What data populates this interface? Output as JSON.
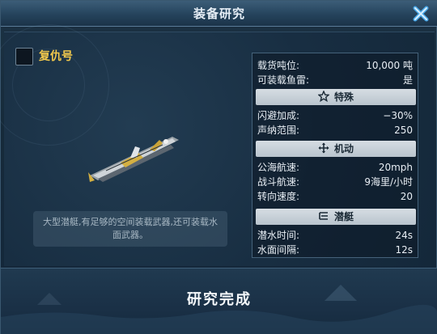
{
  "window": {
    "title": "装备研究"
  },
  "ship": {
    "name": "复仇号",
    "description": "大型潜艇,有足够的空间装载武器,还可装载水面武器。"
  },
  "stats": {
    "base": [
      {
        "label": "载货吨位:",
        "value": "10,000 吨"
      },
      {
        "label": "可装载鱼雷:",
        "value": "是"
      }
    ],
    "sections": [
      {
        "title": "特殊",
        "icon": "star-icon",
        "rows": [
          {
            "label": "闪避加成:",
            "value": "−30%"
          },
          {
            "label": "声纳范围:",
            "value": "250"
          }
        ]
      },
      {
        "title": "机动",
        "icon": "move-arrows-icon",
        "rows": [
          {
            "label": "公海航速:",
            "value": "20mph"
          },
          {
            "label": "战斗航速:",
            "value": "9海里/小时"
          },
          {
            "label": "转向速度:",
            "value": "20"
          }
        ]
      },
      {
        "title": "潜艇",
        "icon": "list-icon",
        "rows": [
          {
            "label": "潜水时间:",
            "value": "24s"
          },
          {
            "label": "水面间隔:",
            "value": "12s"
          }
        ]
      }
    ]
  },
  "actions": {
    "complete_label": "研究完成"
  },
  "colors": {
    "accent_gold": "#f2c94c",
    "close_blue": "#4aa8e8"
  }
}
